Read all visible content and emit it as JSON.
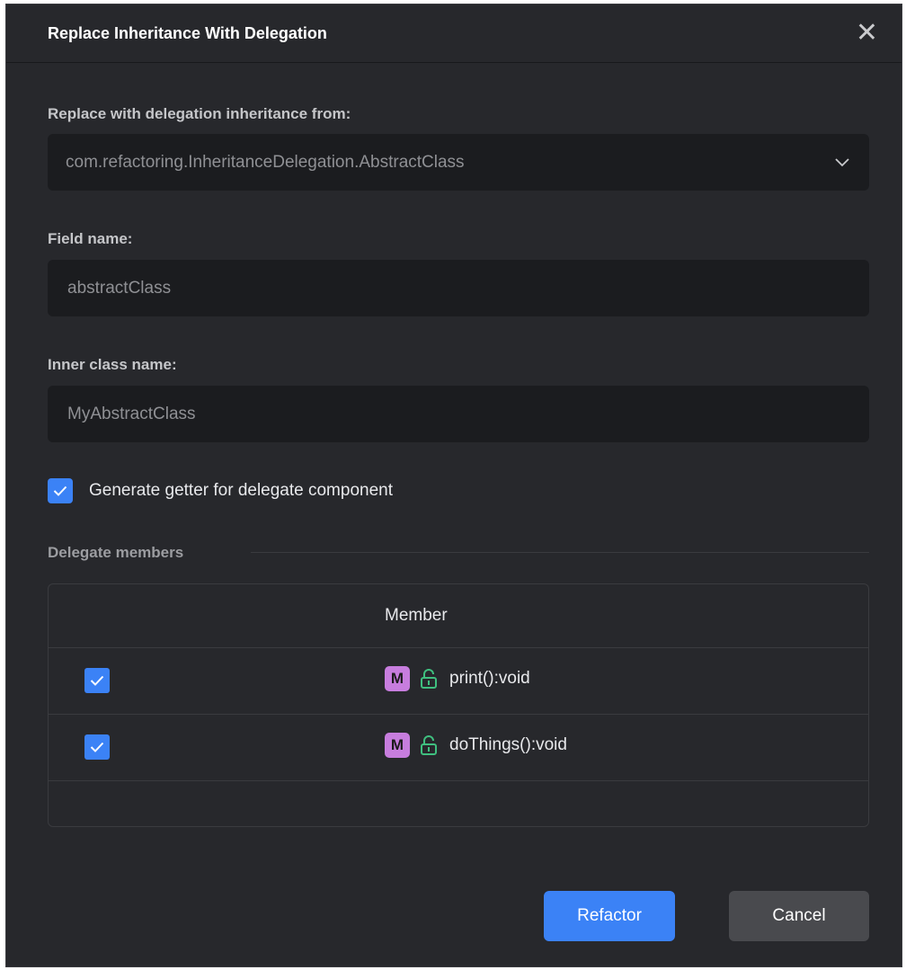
{
  "dialog": {
    "title": "Replace Inheritance With Delegation",
    "close_symbol": "✕"
  },
  "inherit_from": {
    "label": "Replace with delegation inheritance from:",
    "value": "com.refactoring.InheritanceDelegation.AbstractClass",
    "icon": "chevron-down-icon"
  },
  "field_name": {
    "label": "Field name:",
    "value": "abstractClass"
  },
  "inner_class": {
    "label": "Inner class name:",
    "value": "MyAbstractClass"
  },
  "generate_getter": {
    "label": "Generate getter for delegate component",
    "checked": true
  },
  "delegate_members": {
    "label": "Delegate members",
    "column_header": "Member",
    "rows": [
      {
        "checked": true,
        "badge": "M",
        "icon": "unlock-icon",
        "name": "print():void"
      },
      {
        "checked": true,
        "badge": "M",
        "icon": "unlock-icon",
        "name": "doThings():void"
      }
    ]
  },
  "buttons": {
    "refactor": "Refactor",
    "cancel": "Cancel"
  },
  "colors": {
    "background": "#27282c",
    "accent": "#3b82f6",
    "method_badge": "#c77dde",
    "visibility_icon": "#3fbf7f"
  }
}
